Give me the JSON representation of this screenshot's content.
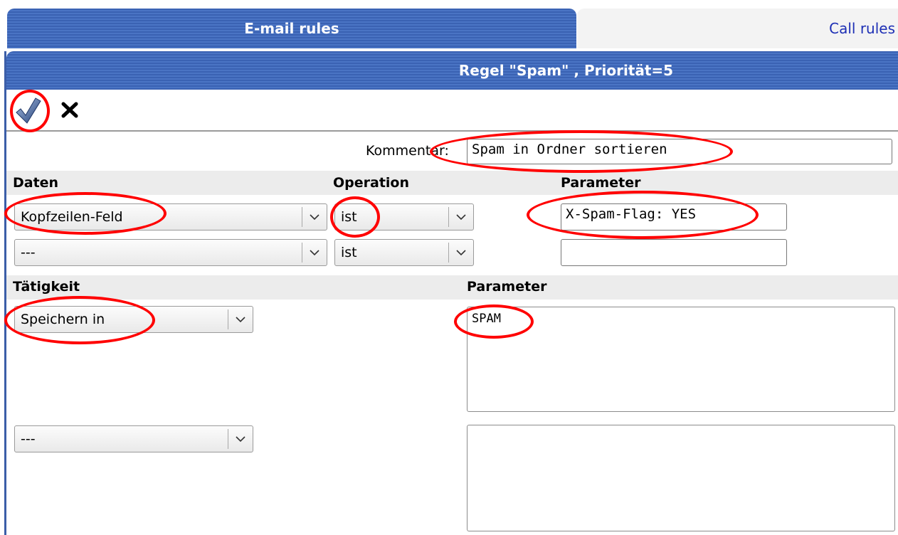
{
  "tabs": {
    "email": "E-mail rules",
    "call": "Call rules"
  },
  "rule_header": "Regel \"Spam\" , Priorität=5",
  "toolbar": {
    "confirm_icon": "checkmark-icon",
    "cancel_icon": "close-icon"
  },
  "comment": {
    "label": "Kommentar:",
    "value": "Spam in Ordner sortieren"
  },
  "conditions": {
    "headers": {
      "data": "Daten",
      "operation": "Operation",
      "parameter": "Parameter"
    },
    "rows": [
      {
        "data": "Kopfzeilen-Feld",
        "operation": "ist",
        "parameter": "X-Spam-Flag: YES"
      },
      {
        "data": "---",
        "operation": "ist",
        "parameter": ""
      }
    ]
  },
  "actions": {
    "headers": {
      "action": "Tätigkeit",
      "parameter": "Parameter"
    },
    "rows": [
      {
        "action": "Speichern in",
        "parameter": "SPAM"
      },
      {
        "action": "---",
        "parameter": ""
      }
    ]
  },
  "colors": {
    "header_blue": "#3a62b3",
    "link_blue": "#1d2fb5",
    "annotation_red": "#ff0000"
  }
}
